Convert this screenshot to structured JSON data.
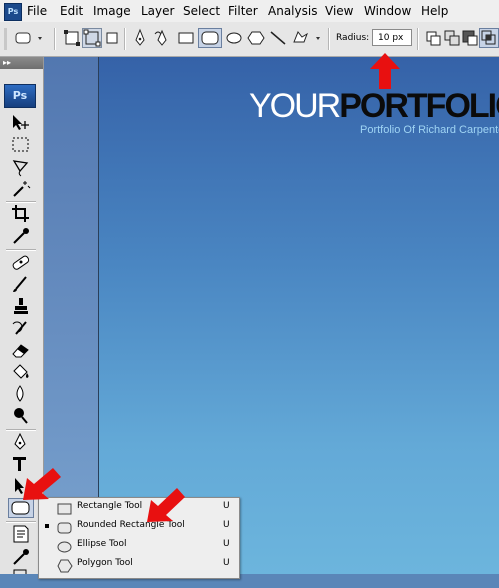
{
  "app": {
    "logo_text": "Ps"
  },
  "menu": {
    "items": [
      "File",
      "Edit",
      "Image",
      "Layer",
      "Select",
      "Filter",
      "Analysis",
      "View",
      "Window",
      "Help"
    ]
  },
  "options_bar": {
    "radius_label": "Radius:",
    "radius_value": "10 px"
  },
  "tools_panel": {
    "badge": "Ps",
    "grip": "▸▸"
  },
  "canvas": {
    "logo_part1": "YOUR",
    "logo_part2": "PORTFOLIO",
    "tagline": "Portfolio Of Richard Carpenter"
  },
  "flyout": {
    "items": [
      {
        "label": "Rectangle Tool",
        "shortcut": "U",
        "icon": "rectangle-icon",
        "selected": false
      },
      {
        "label": "Rounded Rectangle Tool",
        "shortcut": "U",
        "icon": "rounded-rectangle-icon",
        "selected": true
      },
      {
        "label": "Ellipse Tool",
        "shortcut": "U",
        "icon": "ellipse-icon",
        "selected": false
      },
      {
        "label": "Polygon Tool",
        "shortcut": "U",
        "icon": "polygon-icon",
        "selected": false
      }
    ]
  },
  "colors": {
    "arrow": "#e81010",
    "canvas_top": "#3562a8",
    "canvas_bottom": "#6cb5dd",
    "tagline": "#9fd4f4"
  }
}
